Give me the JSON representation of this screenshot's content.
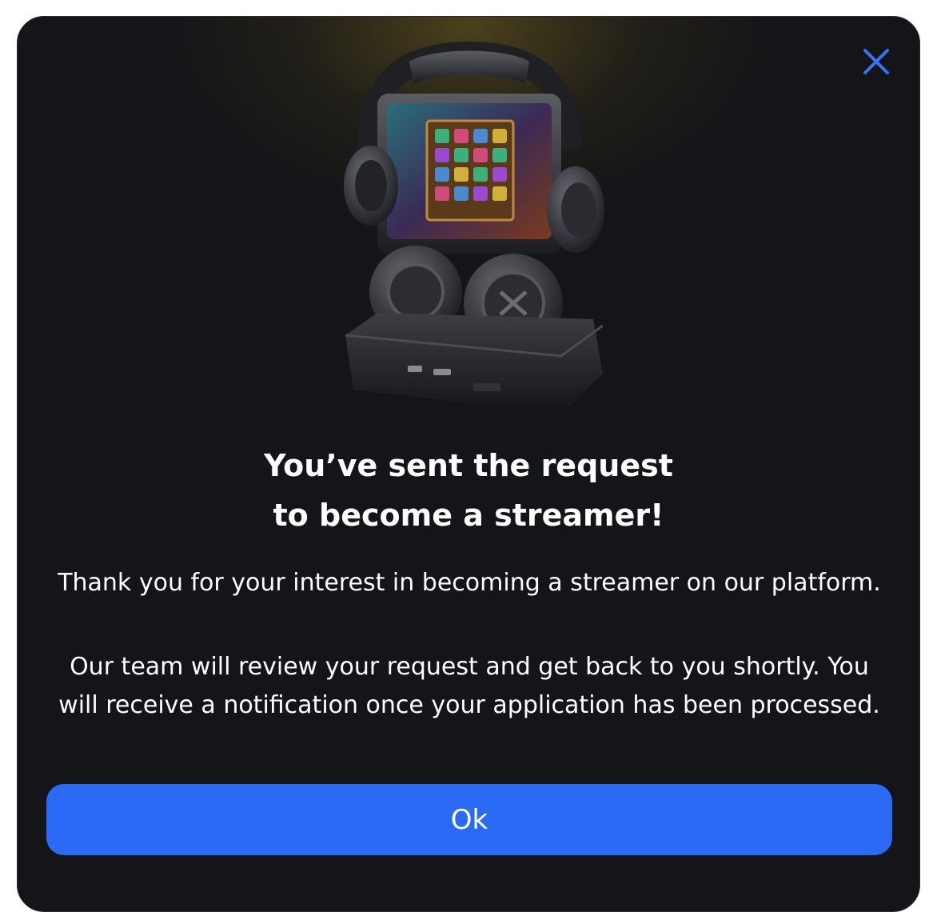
{
  "modal": {
    "close_icon": "close-icon",
    "hero_image": "streaming-console-with-headphones",
    "title_line1": "You’ve sent the request",
    "title_line2": "to become a streamer!",
    "paragraph1": "Thank you for your interest in becoming a streamer on our platform.",
    "paragraph2": "Our team will review your request and get back to you shortly. You will receive a notification once your application has been processed.",
    "ok_label": "Ok",
    "colors": {
      "background": "#141518",
      "accent": "#2b6af5",
      "close_icon": "#3a72f0",
      "text": "#ffffff"
    }
  }
}
